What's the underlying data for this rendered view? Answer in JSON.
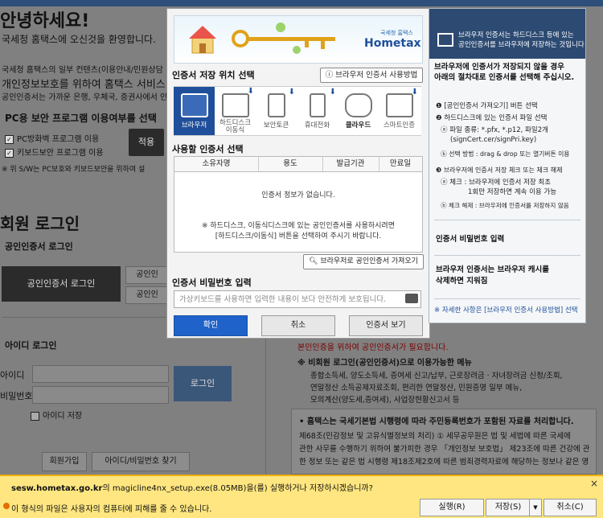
{
  "background_page": {
    "greeting": "안녕하세요!",
    "welcome": "국세청 홈택스에 오신것을 환영합니다.",
    "notice_line1": "국세청 홈택스의 일부 컨텐츠(이용안내/민원상담",
    "notice_line2": "개인정보보호를 위하여 홈택스 서비스",
    "notice_line3": "공인인증서는 가까운 은행, 우체국, 증권사에서 인",
    "security_title": "PC용 보안 프로그램 이용여부를 선택",
    "checkbox_firewall": "PC방화벽 프로그램 이용",
    "checkbox_keyboard": "키보드보안 프로그램 이용",
    "apply_label": "적용",
    "security_note": "※ 위 S/W는 PC보호와 키보드보안을 위하여 설",
    "member_login_title": "회원 로그인",
    "cert_login_label": "공인인증서 로그인",
    "cert_login_button": "공인인증서 로그인",
    "side_button_1": "공인인",
    "side_button_2": "공인인",
    "id_login_label": "아이디 로그인",
    "id_label": "아이디",
    "password_label": "비밀번호",
    "login_button": "로그인",
    "save_id_label": "아이디 저장",
    "join_button": "회원가입",
    "find_button": "아이디/비밀번호 찾기",
    "red_notice": "본인인증을 위하여 공인인증서가 필요합니다.",
    "noncert_title": "※ 비회원 로그인(공인인증서)으로 이용가능한 메뉴",
    "noncert_line1": "종합소득세, 양도소득세, 증여세 신고/납부, 근로장려금 · 자녀장려금 신청/조회,",
    "noncert_line2": "연말정산 소득공제자료조회, 편리한 연말정산, 민원증명 일부 메뉴,",
    "noncert_line3": "모의계산(양도세,증여세), 사업장현황신고서 등",
    "law_title": "• 홈택스는 국세기본법 시행령에 따라 주민등록번호가 포함된 자료를 처리합니다.",
    "law_line1": "제68조(민감정보 및 고유식별정보의 처리) ① 세무공무원은 법 및 세법에 따른 국세에",
    "law_line2": "관한 사무를 수행하기 위하여 불가피한 경우 「개인정보 보호법」 제23조에 따른 건강에 관",
    "law_line3": "한 정보 또는 같은 법 시행령 제18조제2호에 따른 범죄경력자료에 해당하는 정보나 같은 영"
  },
  "dialog": {
    "banner_brand": "Hometax.",
    "banner_brand_sub": "국세청 홈택스",
    "location_title": "인증서 저장 위치 선택",
    "help_button": "브라우저 인증서 사용방법",
    "locations": [
      {
        "label": "브라우저"
      },
      {
        "label": "하드디스크\n이동식"
      },
      {
        "label": "보안토큰"
      },
      {
        "label": "휴대전화"
      },
      {
        "label": "클라우드"
      },
      {
        "label": "스마트인증"
      }
    ],
    "cert_list_title": "사용할 인증서 선택",
    "columns": [
      "소유자명",
      "용도",
      "발급기관",
      "만료일"
    ],
    "empty_message": "인증서 정보가 없습니다.",
    "hint_line1": "※ 하드디스크, 이동식디스크에 있는 공인인증서를 사용하시려면",
    "hint_line2": "[하드디스크/이동식] 버튼을 선택하여 주시기 바랍니다.",
    "import_button": "브라우저로 공인인증서 가져오기",
    "password_title": "인증서 비밀번호 입력",
    "password_placeholder": "가상키보드를 사용하면 입력한 내용이 보다 안전하게 보호됩니다.",
    "ok_button": "확인",
    "cancel_button": "취소",
    "view_button": "인증서 보기"
  },
  "right_panel": {
    "header_line1": "브라우저 인증서는 하드디스크 등에 있는",
    "header_line2": "공인인증서를 브라우저에 저장하는 것입니다",
    "intro_line1": "브라우저에 인증서가 저장되지 않을 경우",
    "intro_line2": "아래의 절차대로 인증서를 선택해 주십시오.",
    "step1": "❶ [공인인증서 가져오기] 버튼 선택",
    "step2": "❷ 하드디스크에 있는 인증서 파일 선택",
    "step2a": "ⓐ 파일 종류: *.pfx, *.p12, 파일2개",
    "step2a2": "(signCert.cer/signPri.key)",
    "step2b": "ⓑ 선택 방법 : drag & drop 또는 열기버튼 이용",
    "step3": "❸ 브라우저에 인증서 저장 체크 또는 체크 해제",
    "step3a": "ⓐ 체크 : 브라우저에 인증서 저장 최초",
    "step3a2": "1회만 저장하면 계속 이용 가능",
    "step3b": "ⓑ 체크 해제 : 브라우저에 인증서를 저장하지 않음",
    "pw_input_note": "인증서 비밀번호 입력",
    "cache_line1": "브라우저 인증서는 브라우저 캐시를",
    "cache_line2": "삭제하면 지워짐",
    "footer": "※ 자세한 사항은 [브라우저 인증서 사용방법] 선택"
  },
  "download_bar": {
    "message_site": "sesw.hometax.go.kr",
    "message_rest": "의 magicline4nx_setup.exe(8.05MB)을(를) 실행하거나 저장하시겠습니까?",
    "warning": "이 형식의 파일은 사용자의 컴퓨터에 피해를 줄 수 있습니다.",
    "run_button": "실행(R)",
    "save_button": "저장(S)",
    "save_arrow": "▼",
    "cancel_button": "취소(C)",
    "close_glyph": "×"
  }
}
